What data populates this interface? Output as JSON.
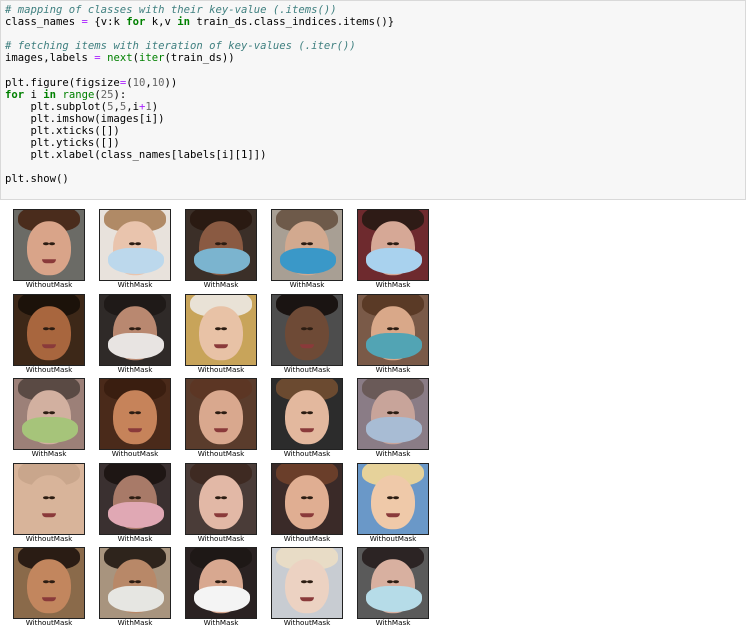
{
  "code": {
    "lines": [
      [
        [
          "cm",
          "# mapping of classes with their key-value (.items())"
        ]
      ],
      [
        [
          "t",
          "class_names "
        ],
        [
          "op",
          "="
        ],
        [
          "t",
          " {v:k "
        ],
        [
          "kw",
          "for"
        ],
        [
          "t",
          " k,v "
        ],
        [
          "kw",
          "in"
        ],
        [
          "t",
          " train_ds.class_indices.items()}"
        ]
      ],
      [],
      [
        [
          "cm",
          "# fetching items with iteration of key-values (.iter())"
        ]
      ],
      [
        [
          "t",
          "images,labels "
        ],
        [
          "op",
          "="
        ],
        [
          "t",
          " "
        ],
        [
          "nb",
          "next"
        ],
        [
          "t",
          "("
        ],
        [
          "nb",
          "iter"
        ],
        [
          "t",
          "(train_ds))"
        ]
      ],
      [],
      [
        [
          "t",
          "plt.figure(figsize"
        ],
        [
          "op",
          "="
        ],
        [
          "t",
          "("
        ],
        [
          "num",
          "10"
        ],
        [
          "t",
          ","
        ],
        [
          "num",
          "10"
        ],
        [
          "t",
          "))"
        ]
      ],
      [
        [
          "kw",
          "for"
        ],
        [
          "t",
          " i "
        ],
        [
          "kw",
          "in"
        ],
        [
          "t",
          " "
        ],
        [
          "nb",
          "range"
        ],
        [
          "t",
          "("
        ],
        [
          "num",
          "25"
        ],
        [
          "t",
          "):"
        ]
      ],
      [
        [
          "t",
          "    plt.subplot("
        ],
        [
          "num",
          "5"
        ],
        [
          "t",
          ","
        ],
        [
          "num",
          "5"
        ],
        [
          "t",
          ",i"
        ],
        [
          "op",
          "+"
        ],
        [
          "num",
          "1"
        ],
        [
          "t",
          ")"
        ]
      ],
      [
        [
          "t",
          "    plt.imshow(images[i])"
        ]
      ],
      [
        [
          "t",
          "    plt.xticks([])"
        ]
      ],
      [
        [
          "t",
          "    plt.yticks([])"
        ]
      ],
      [
        [
          "t",
          "    plt.xlabel(class_names[labels[i][1]])"
        ]
      ],
      [],
      [
        [
          "t",
          "plt.show()"
        ]
      ]
    ]
  },
  "output": {
    "images": [
      {
        "label": "WithoutMask",
        "bg": "#6b6b66",
        "skin": "#d9a489",
        "hair": "#4a2c1c",
        "mask": null
      },
      {
        "label": "WithMask",
        "bg": "#e8e2dc",
        "skin": "#e9c4ad",
        "hair": "#b08a66",
        "mask": "#bcd8ec"
      },
      {
        "label": "WithMask",
        "bg": "#3b2f28",
        "skin": "#8a5a42",
        "hair": "#2a1a12",
        "mask": "#7bb4cf"
      },
      {
        "label": "WithMask",
        "bg": "#a89f94",
        "skin": "#d2a98f",
        "hair": "#6e5a4a",
        "mask": "#3a98c8"
      },
      {
        "label": "WithMask",
        "bg": "#6e2a2e",
        "skin": "#d6a896",
        "hair": "#2e1b16",
        "mask": "#a9d2ee"
      },
      {
        "label": "WithoutMask",
        "bg": "#3d2818",
        "skin": "#a8663e",
        "hair": "#1c120a",
        "mask": null
      },
      {
        "label": "WithMask",
        "bg": "#2f2a28",
        "skin": "#b98870",
        "hair": "#1f1a18",
        "mask": "#e8e4e2"
      },
      {
        "label": "WithoutMask",
        "bg": "#c8a45a",
        "skin": "#e8c2a6",
        "hair": "#e9e2d6",
        "mask": null
      },
      {
        "label": "WithoutMask",
        "bg": "#4d4d4d",
        "skin": "#6e4a36",
        "hair": "#1a1412",
        "mask": null
      },
      {
        "label": "WithMask",
        "bg": "#7a5a48",
        "skin": "#d9a889",
        "hair": "#5a3a26",
        "mask": "#52a4b4"
      },
      {
        "label": "WithMask",
        "bg": "#9c8078",
        "skin": "#d2b0a0",
        "hair": "#5a4a44",
        "mask": "#a6c47a"
      },
      {
        "label": "WithoutMask",
        "bg": "#4a2a1a",
        "skin": "#c6835a",
        "hair": "#3a1e10",
        "mask": null
      },
      {
        "label": "WithoutMask",
        "bg": "#5a3c2c",
        "skin": "#d9a88e",
        "hair": "#5c3624",
        "mask": null
      },
      {
        "label": "WithoutMask",
        "bg": "#2c2c2c",
        "skin": "#e3b89e",
        "hair": "#6b4a30",
        "mask": null
      },
      {
        "label": "WithMask",
        "bg": "#8a7c86",
        "skin": "#c8a49a",
        "hair": "#6a5a58",
        "mask": "#a8bcd4"
      },
      {
        "label": "WithoutMask",
        "bg": "#d8b49a",
        "skin": "#d8b49a",
        "hair": "#c9a68c",
        "mask": null
      },
      {
        "label": "WithMask",
        "bg": "#3a3030",
        "skin": "#a87a68",
        "hair": "#1e1614",
        "mask": "#e0a8b4"
      },
      {
        "label": "WithoutMask",
        "bg": "#4a3c38",
        "skin": "#e2b8a6",
        "hair": "#3e2a22",
        "mask": null
      },
      {
        "label": "WithoutMask",
        "bg": "#3a2a28",
        "skin": "#e0ae92",
        "hair": "#6a3e2a",
        "mask": null
      },
      {
        "label": "WithoutMask",
        "bg": "#6a98c8",
        "skin": "#efc9a9",
        "hair": "#e6d29a",
        "mask": null
      },
      {
        "label": "WithoutMask",
        "bg": "#8a6a4a",
        "skin": "#c2865e",
        "hair": "#2a1c14",
        "mask": null
      },
      {
        "label": "WithMask",
        "bg": "#a8947e",
        "skin": "#b88868",
        "hair": "#2e241c",
        "mask": "#e6e6e2"
      },
      {
        "label": "WithMask",
        "bg": "#2a2222",
        "skin": "#d8a890",
        "hair": "#1e1816",
        "mask": "#f4f4f4"
      },
      {
        "label": "WithoutMask",
        "bg": "#c8ccd2",
        "skin": "#ecd2c2",
        "hair": "#e8dcc6",
        "mask": null
      },
      {
        "label": "WithMask",
        "bg": "#5a5a5a",
        "skin": "#d8b0a0",
        "hair": "#2c2424",
        "mask": "#b6dce8"
      }
    ]
  }
}
